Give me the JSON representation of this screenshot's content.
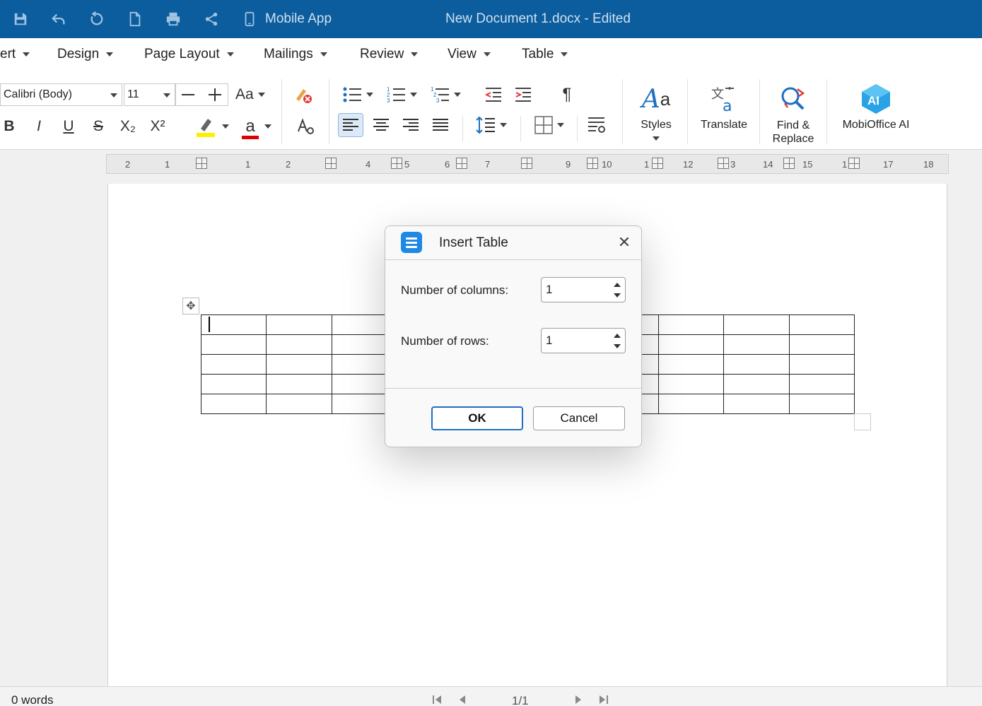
{
  "titlebar": {
    "mobile_label": "Mobile App",
    "doc_title": "New Document 1.docx - Edited",
    "icons": [
      "save-icon",
      "undo-icon",
      "redo-icon",
      "new-document-icon",
      "print-icon",
      "share-icon",
      "mobile-icon"
    ]
  },
  "menu": {
    "tabs": [
      "ert",
      "Design",
      "Page Layout",
      "Mailings",
      "Review",
      "View",
      "Table"
    ]
  },
  "ribbon": {
    "font_name": "Calibri (Body)",
    "font_size": "11",
    "change_case": "Aa",
    "bold": "B",
    "italic": "I",
    "underline": "U",
    "strike": "S",
    "subscript": "X₂",
    "superscript": "X²",
    "font_color_letter": "a",
    "pilcrow": "¶",
    "styles_label": "Styles",
    "translate_label": "Translate",
    "find_replace_line1": "Find &",
    "find_replace_line2": "Replace",
    "ai_label": "MobiOffice AI",
    "ai_badge": "AI",
    "highlight_color": "#ffee00",
    "font_color": "#e00000"
  },
  "ruler": {
    "labels": [
      "2",
      "1",
      "1",
      "2",
      "4",
      "5",
      "6",
      "7",
      "9",
      "10",
      "1",
      "12",
      "3",
      "14",
      "15",
      "1",
      "17",
      "18"
    ]
  },
  "document": {
    "table": {
      "columns": 10,
      "rows": 5
    }
  },
  "dialog": {
    "title": "Insert Table",
    "columns_label": "Number of columns:",
    "columns_value": "1",
    "rows_label": "Number of rows:",
    "rows_value": "1",
    "ok_label": "OK",
    "cancel_label": "Cancel"
  },
  "status": {
    "word_count": "0 words",
    "page_indicator": "1/1"
  },
  "colors": {
    "titlebar": "#0b5d9e",
    "accent": "#1e88e5"
  }
}
